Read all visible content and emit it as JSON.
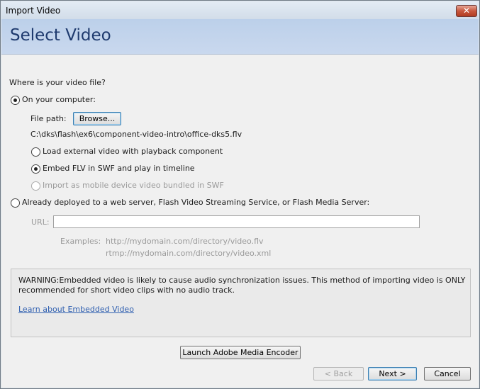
{
  "window": {
    "title": "Import Video",
    "close_label": "✕"
  },
  "header": {
    "heading": "Select Video"
  },
  "question": "Where is your video file?",
  "computer_option": {
    "label": "On your computer:",
    "checked": true
  },
  "file_path": {
    "label": "File path:",
    "browse_label": "Browse...",
    "value": "C:\\dks\\flash\\ex6\\component-video-intro\\office-dks5.flv"
  },
  "sub_options": [
    {
      "label": "Load external video with playback component",
      "checked": false,
      "enabled": true
    },
    {
      "label": "Embed FLV in SWF and play in timeline",
      "checked": true,
      "enabled": true
    },
    {
      "label": "Import as mobile device video bundled in SWF",
      "checked": false,
      "enabled": false
    }
  ],
  "server_option": {
    "label": "Already deployed to a web server, Flash Video Streaming Service, or Flash Media Server:",
    "checked": false
  },
  "url": {
    "label": "URL:",
    "value": ""
  },
  "examples": {
    "label": "Examples:",
    "line1": "http://mydomain.com/directory/video.flv",
    "line2": "rtmp://mydomain.com/directory/video.xml"
  },
  "warning": {
    "text_line1": "WARNING:Embedded video is likely to cause audio synchronization issues. This method of importing video is ONLY",
    "text_line2": "recommended for short video clips with no audio track.",
    "link": "Learn about Embedded Video"
  },
  "encoder_button": "Launch Adobe Media Encoder",
  "nav": {
    "back": "< Back",
    "next": "Next >",
    "cancel": "Cancel"
  }
}
